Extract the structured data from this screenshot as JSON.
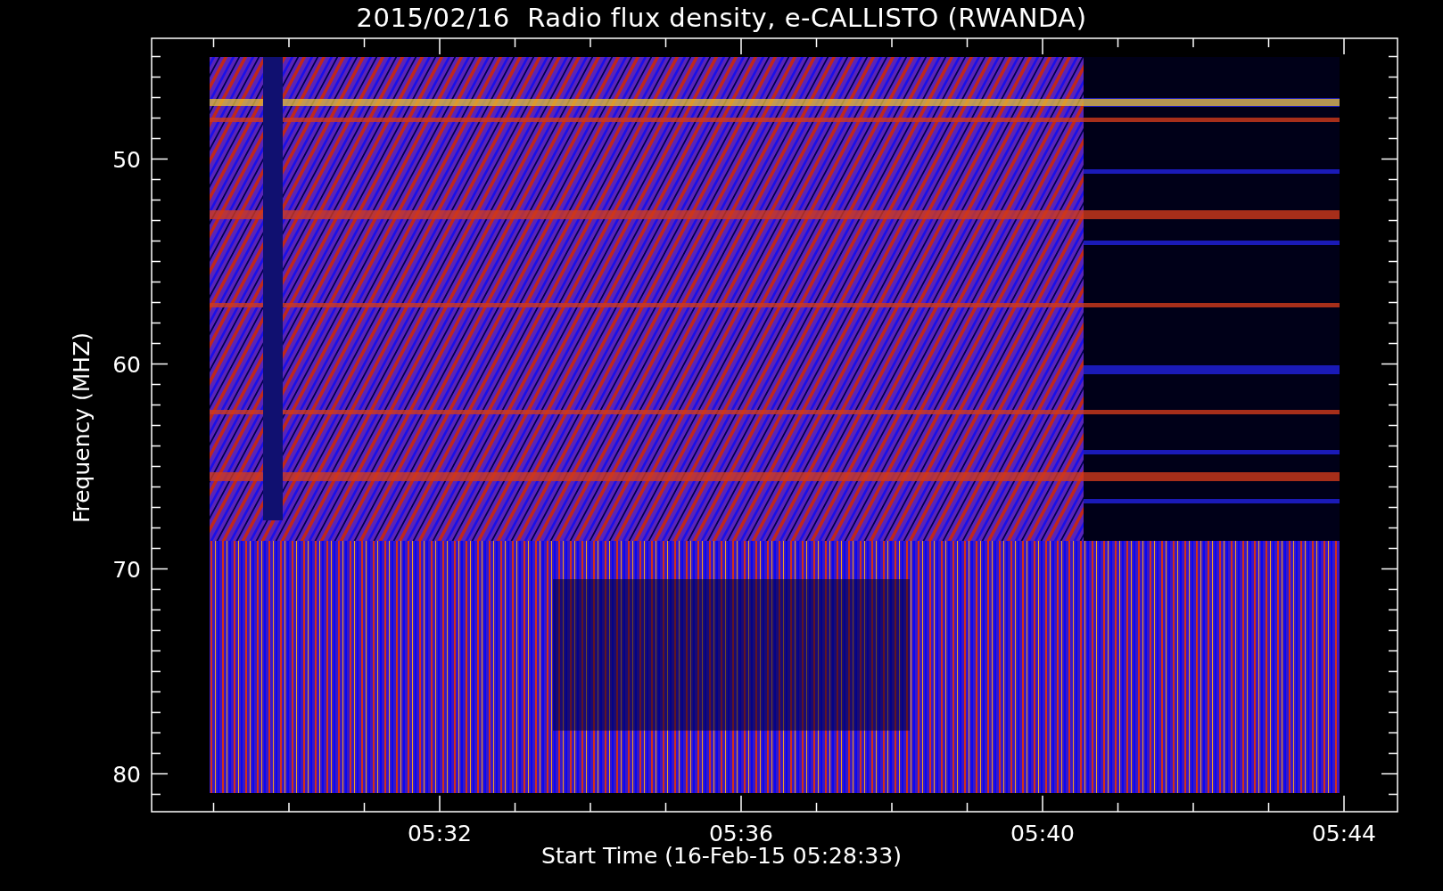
{
  "plot": {
    "title": "2015/02/16  Radio flux density, e-CALLISTO (RWANDA)",
    "ylabel": "Frequency (MHZ)",
    "yticks": [
      "50",
      "60",
      "70",
      "80"
    ],
    "xlabel": "Start Time (16-Feb-15 05:28:33)",
    "xticks": [
      "05:32",
      "05:36",
      "05:40",
      "05:44"
    ]
  }
}
